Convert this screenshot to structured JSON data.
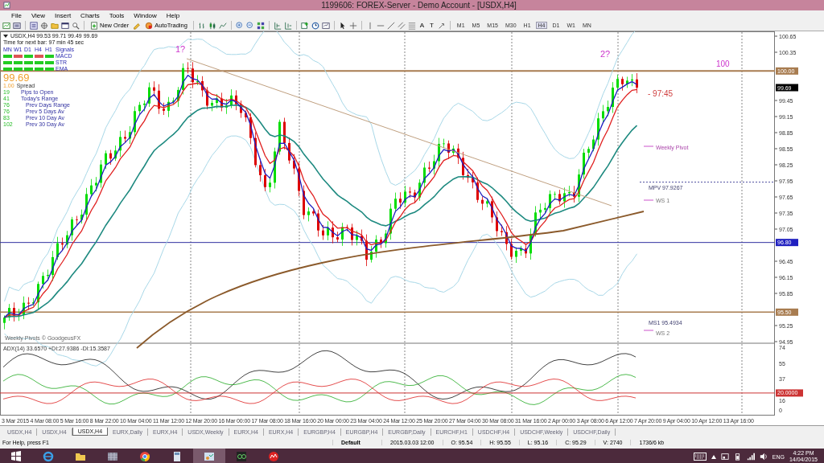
{
  "window": {
    "title": "1199606: FOREX-Server - Demo Account - [USDX,H4]"
  },
  "menu": [
    "File",
    "View",
    "Insert",
    "Charts",
    "Tools",
    "Window",
    "Help"
  ],
  "toolbar": {
    "new_order": "New Order",
    "autotrading": "AutoTrading",
    "text_tools": [
      "A",
      "T"
    ],
    "timeframes": [
      {
        "label": "M1",
        "selected": false
      },
      {
        "label": "M5",
        "selected": false
      },
      {
        "label": "M15",
        "selected": false
      },
      {
        "label": "M30",
        "selected": false
      },
      {
        "label": "H1",
        "selected": false
      },
      {
        "label": "H4",
        "selected": true
      },
      {
        "label": "D1",
        "selected": false
      },
      {
        "label": "W1",
        "selected": false
      },
      {
        "label": "MN",
        "selected": false
      }
    ]
  },
  "chart": {
    "header": "USDX,H4  99.53 99.71 99.49 99.69",
    "timer": "Time for next bar: 97 min 45 sec",
    "signals": {
      "title": "Signals",
      "columns": [
        "MN",
        "W1",
        "D1",
        "H4",
        "H1"
      ],
      "rows": [
        {
          "label": "MACD",
          "cells": [
            true,
            false,
            true,
            false,
            true
          ]
        },
        {
          "label": "STR",
          "cells": [
            true,
            true,
            true,
            true,
            true
          ]
        },
        {
          "label": "EMA",
          "cells": [
            true,
            true,
            true,
            true,
            true
          ]
        }
      ]
    },
    "price": "99.69",
    "spread_value": "1.00",
    "spread_label": "Spread",
    "stats": [
      {
        "value": "19",
        "label": "Pips to Open",
        "kind": "main"
      },
      {
        "value": "41",
        "label": "Today's Range",
        "kind": "main"
      },
      {
        "value": "76",
        "label": "Prev Days Range",
        "kind": "sub"
      },
      {
        "value": "76",
        "label": "Prev 5 Days Av",
        "kind": "sub"
      },
      {
        "value": "83",
        "label": "Prev 10 Day Av",
        "kind": "sub"
      },
      {
        "value": "102",
        "label": "Prev 30 Day Av",
        "kind": "sub"
      }
    ],
    "annotations": {
      "first_peak": "1?",
      "second_peak": "2?",
      "level_label": "100",
      "countdown": "- 97:45",
      "weekly_pivot": "Weekly Pivot",
      "mpv": "MPV  97.9267",
      "ws1": "WS 1",
      "ms1": "MS1  95.4934",
      "ws2": "WS 2",
      "credit": "Weekly Pivots © GoodgeusFX"
    },
    "price_axis": [
      "100.65",
      "100.35",
      "99.45",
      "99.15",
      "98.85",
      "98.55",
      "98.25",
      "97.95",
      "97.65",
      "97.35",
      "97.05",
      "96.45",
      "96.15",
      "95.85",
      "95.25",
      "94.95"
    ],
    "price_markers": [
      {
        "label": "100.00",
        "color": "#a87c50"
      },
      {
        "label": "99.69",
        "color": "#000000"
      },
      {
        "label": "96.80",
        "color": "#2020c0"
      },
      {
        "label": "95.50",
        "color": "#a87c50"
      }
    ],
    "indicator": {
      "title": "ADX(14) 33.6570 +DI:27.9386 -DI:15.3587",
      "axis": [
        "74",
        "55",
        "37",
        "16",
        "0"
      ],
      "marker": "20.0000"
    },
    "time_axis": [
      "3 Mar 2015",
      "4 Mar 08:00",
      "5 Mar 16:00",
      "8 Mar 22:00",
      "10 Mar 04:00",
      "11 Mar 12:00",
      "12 Mar 20:00",
      "16 Mar 00:00",
      "17 Mar 08:00",
      "18 Mar 16:00",
      "20 Mar 00:00",
      "23 Mar 04:00",
      "24 Mar 12:00",
      "25 Mar 20:00",
      "27 Mar 04:00",
      "30 Mar 08:00",
      "31 Mar 16:00",
      "2 Apr 00:00",
      "3 Apr 08:00",
      "6 Apr 12:00",
      "7 Apr 20:00",
      "9 Apr 04:00",
      "10 Apr 12:00",
      "13 Apr 16:00"
    ]
  },
  "tabs": [
    {
      "label": "USDX,H4",
      "selected": false
    },
    {
      "label": "USDX,H4",
      "selected": false
    },
    {
      "label": "USDX,H4",
      "selected": true
    },
    {
      "label": "EURX,Daily",
      "selected": false
    },
    {
      "label": "EURX,H4",
      "selected": false
    },
    {
      "label": "USDX,Weekly",
      "selected": false
    },
    {
      "label": "EURX,H4",
      "selected": false
    },
    {
      "label": "EURX,H4",
      "selected": false
    },
    {
      "label": "EURGBP,H4",
      "selected": false
    },
    {
      "label": "EURGBP,H4",
      "selected": false
    },
    {
      "label": "EURGBP,Daily",
      "selected": false
    },
    {
      "label": "EURCHF,H1",
      "selected": false
    },
    {
      "label": "USDCHF,H4",
      "selected": false
    },
    {
      "label": "USDCHF,Weekly",
      "selected": false
    },
    {
      "label": "USDCHF,Daily",
      "selected": false
    }
  ],
  "status_bar": {
    "help": "For Help, press F1",
    "fields": [
      "Default",
      "2015.03.03 12:00",
      "O: 95.54",
      "H: 95.55",
      "L: 95.16",
      "C: 95.29",
      "V: 2740",
      "1736/6 kb"
    ]
  },
  "taskbar": {
    "language": "ENG",
    "time": "4:22 PM",
    "date": "14/04/2015"
  }
}
